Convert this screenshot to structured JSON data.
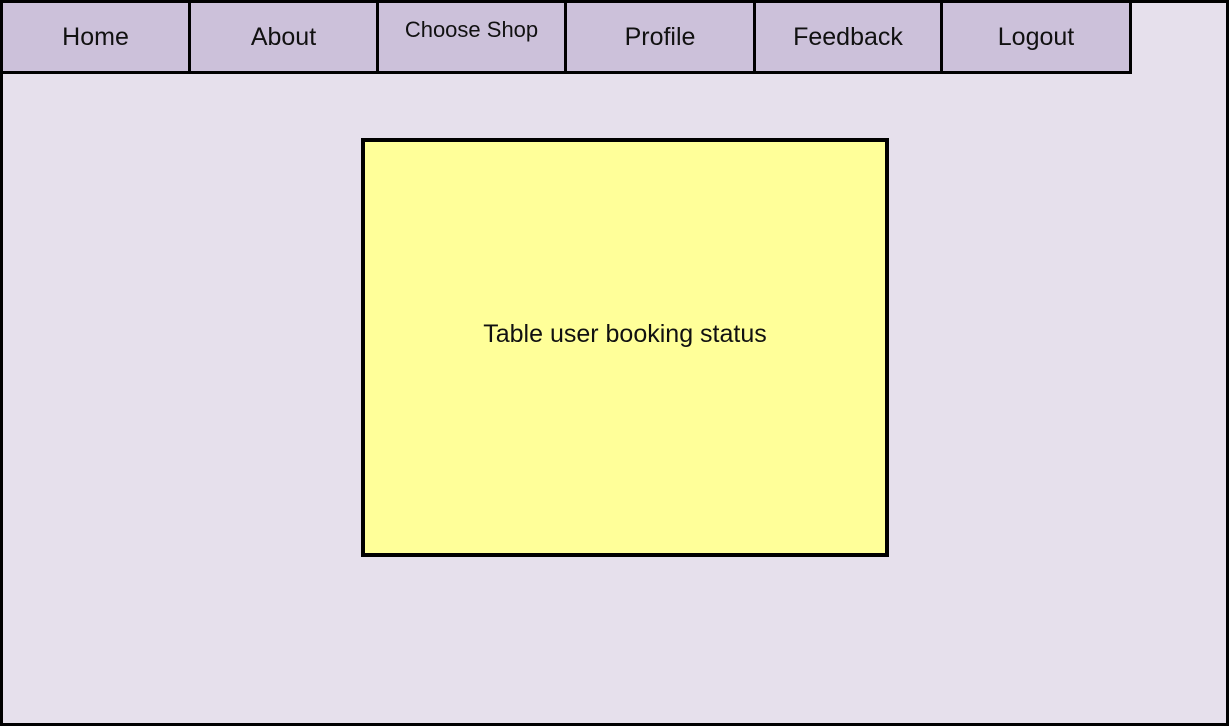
{
  "nav": {
    "tabs": [
      {
        "label": "Home"
      },
      {
        "label": "About"
      },
      {
        "label": "Choose Shop"
      },
      {
        "label": "Profile"
      },
      {
        "label": "Feedback"
      },
      {
        "label": "Logout"
      }
    ]
  },
  "main": {
    "status_box_label": "Table user booking status"
  },
  "colors": {
    "background": "#e6e0ec",
    "tab_fill": "#ccc1da",
    "status_box_fill": "#ffff99",
    "border": "#000000"
  }
}
